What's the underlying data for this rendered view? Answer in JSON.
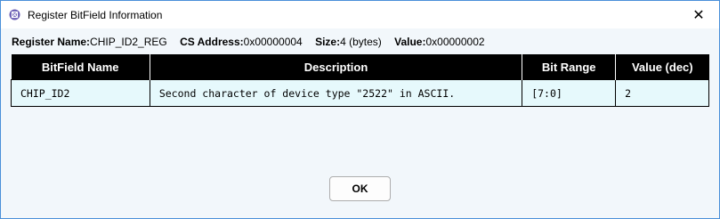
{
  "window": {
    "title": "Register BitField Information",
    "close_glyph": "✕",
    "accent_color": "#4a90d9"
  },
  "register_info": {
    "name_label": "Register Name:",
    "name_value": "CHIP_ID2_REG",
    "address_label": "CS Address:",
    "address_value": "0x00000004",
    "size_label": "Size:",
    "size_value": "4 (bytes)",
    "value_label": "Value:",
    "value_value": "0x00000002"
  },
  "table": {
    "headers": [
      "BitField Name",
      "Description",
      "Bit Range",
      "Value (dec)"
    ],
    "rows": [
      {
        "name": "CHIP_ID2",
        "description": "Second character of device type \"2522\" in ASCII.",
        "bit_range": "[7:0]",
        "value": "2"
      }
    ]
  },
  "buttons": {
    "ok_label": "OK"
  }
}
